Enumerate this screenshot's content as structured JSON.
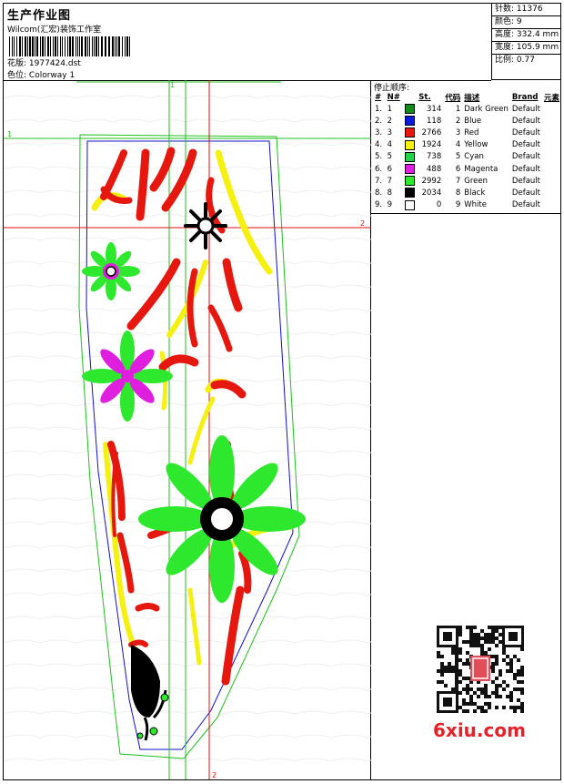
{
  "header": {
    "title": "生产作业图",
    "subtitle": "Wilcom(汇宏)装饰工作室",
    "design_label": "花版:",
    "design_value": "1977424.dst",
    "colorway_label": "色位:",
    "colorway_value": "Colorway 1"
  },
  "stats": [
    {
      "label": "针数:",
      "value": "11376"
    },
    {
      "label": "颜色:",
      "value": "9"
    },
    {
      "label": "高度:",
      "value": "332.4 mm"
    },
    {
      "label": "宽度:",
      "value": "105.9 mm"
    },
    {
      "label": "比例:",
      "value": "0.77"
    }
  ],
  "sequence": {
    "title": "停止顺序:",
    "columns": [
      "#",
      "N#",
      "St.",
      "代码",
      "描述",
      "Brand",
      "元素"
    ],
    "rows": [
      {
        "idx": "1.",
        "n": "1",
        "color": "#138a1a",
        "st": "314",
        "code": "1",
        "desc": "Dark Green",
        "brand": "Default"
      },
      {
        "idx": "2.",
        "n": "2",
        "color": "#0a1ad6",
        "st": "118",
        "code": "2",
        "desc": "Blue",
        "brand": "Default"
      },
      {
        "idx": "3.",
        "n": "3",
        "color": "#e5170f",
        "st": "2766",
        "code": "3",
        "desc": "Red",
        "brand": "Default"
      },
      {
        "idx": "4.",
        "n": "4",
        "color": "#f5f010",
        "st": "1924",
        "code": "4",
        "desc": "Yellow",
        "brand": "Default"
      },
      {
        "idx": "5.",
        "n": "5",
        "color": "#22d44a",
        "st": "738",
        "code": "5",
        "desc": "Cyan",
        "brand": "Default"
      },
      {
        "idx": "6.",
        "n": "6",
        "color": "#e01ee0",
        "st": "488",
        "code": "6",
        "desc": "Magenta",
        "brand": "Default"
      },
      {
        "idx": "7.",
        "n": "7",
        "color": "#2ee82e",
        "st": "2992",
        "code": "7",
        "desc": "Green",
        "brand": "Default"
      },
      {
        "idx": "8.",
        "n": "8",
        "color": "#000000",
        "st": "2034",
        "code": "8",
        "desc": "Black",
        "brand": "Default"
      },
      {
        "idx": "9.",
        "n": "9",
        "color": "#ffffff",
        "st": "0",
        "code": "9",
        "desc": "White",
        "brand": "Default"
      }
    ]
  },
  "guides": {
    "v1": "1",
    "h1": "1",
    "h2": "2",
    "v2": "2"
  },
  "watermark": "6xiu.com",
  "colors": {
    "guide_green": "#1fbf1f",
    "guide_red": "#e01010",
    "outline_blue": "#1010c8"
  }
}
